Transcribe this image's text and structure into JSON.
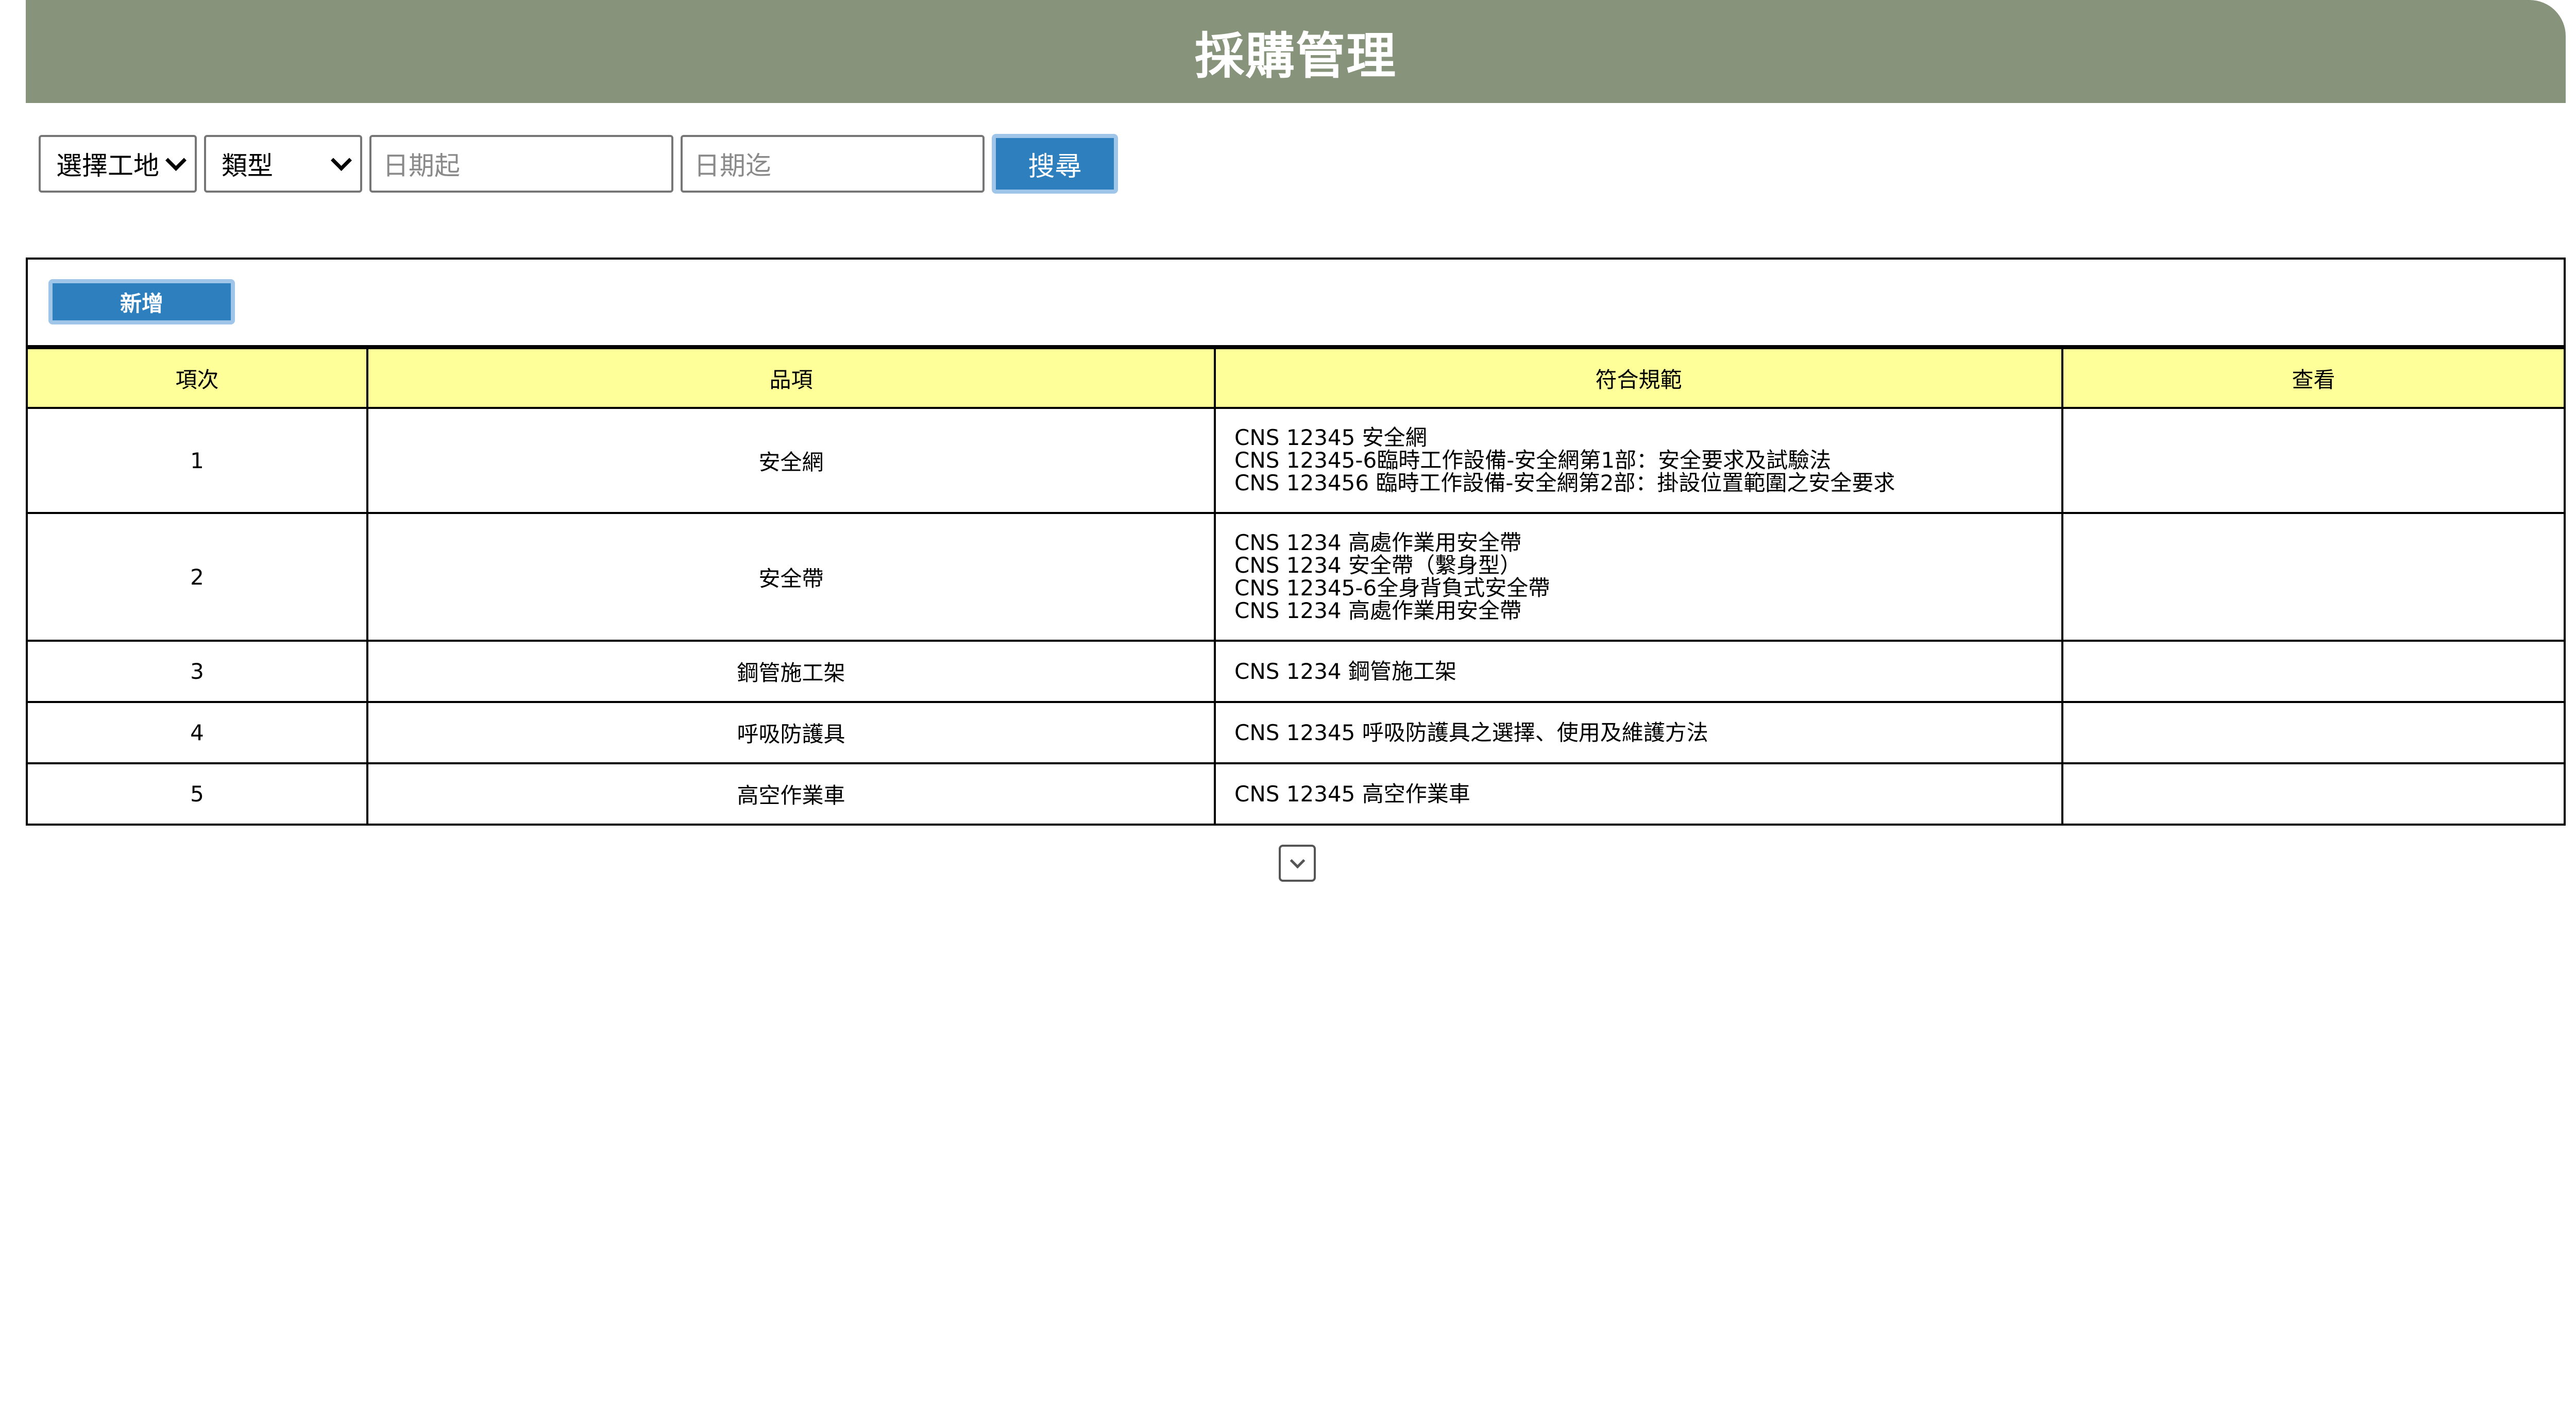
{
  "header": {
    "title": "採購管理"
  },
  "filters": {
    "site_select": "選擇工地",
    "type_select": "類型",
    "date_from_placeholder": "日期起",
    "date_to_placeholder": "日期迄",
    "search_label": "搜尋"
  },
  "toolbar": {
    "add_label": "新增"
  },
  "table": {
    "headers": [
      "項次",
      "品項",
      "符合規範",
      "查看"
    ],
    "rows": [
      {
        "no": "1",
        "item": "安全網",
        "specs": [
          "CNS 12345 安全網",
          "CNS 12345-6臨時工作設備-安全網第1部：安全要求及試驗法",
          "CNS 123456 臨時工作設備-安全網第2部：掛設位置範圍之安全要求"
        ],
        "view": ""
      },
      {
        "no": "2",
        "item": "安全帶",
        "specs": [
          "CNS 1234 高處作業用安全帶",
          "CNS 1234 安全帶（繫身型）",
          "CNS 12345-6全身背負式安全帶",
          "CNS 1234 高處作業用安全帶"
        ],
        "view": ""
      },
      {
        "no": "3",
        "item": "鋼管施工架",
        "specs": [
          "CNS 1234 鋼管施工架"
        ],
        "view": ""
      },
      {
        "no": "4",
        "item": "呼吸防護具",
        "specs": [
          "CNS 12345 呼吸防護具之選擇、使用及維護方法"
        ],
        "view": ""
      },
      {
        "no": "5",
        "item": "高空作業車",
        "specs": [
          "CNS 12345 高空作業車"
        ],
        "view": ""
      }
    ]
  },
  "icons": {
    "select_arrow": "chevron-down-icon",
    "more": "chevron-down-icon"
  },
  "colors": {
    "header_bg": "#87937a",
    "button_bg": "#2e7fbd",
    "table_header_bg": "#ffff99"
  }
}
